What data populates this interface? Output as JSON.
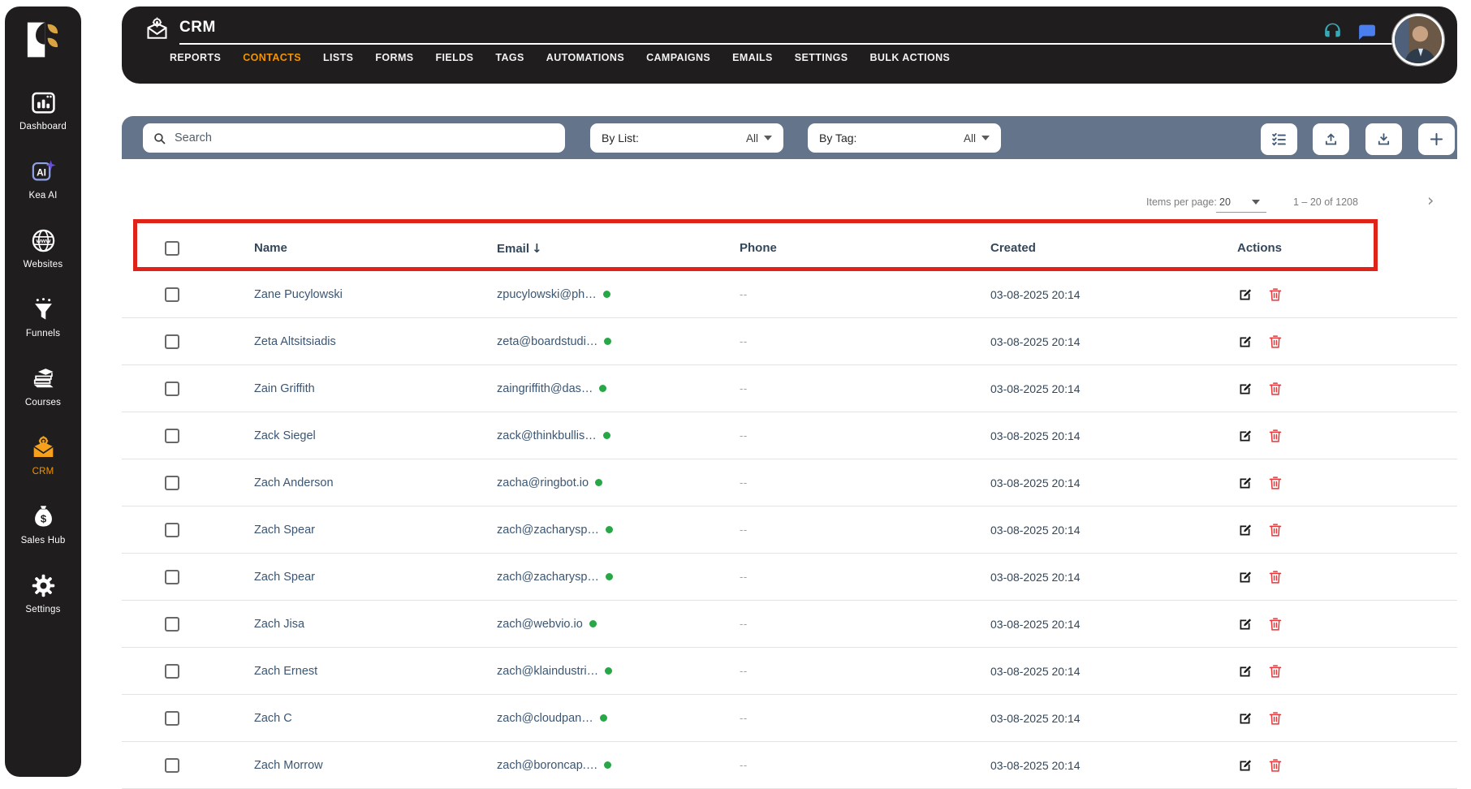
{
  "app": {
    "title": "CRM"
  },
  "sidebar": {
    "logo_icon": "kea-bird-logo",
    "items": [
      {
        "label": "Dashboard",
        "icon": "dashboard-icon",
        "active": false
      },
      {
        "label": "Kea AI",
        "icon": "kea-ai-icon",
        "active": false
      },
      {
        "label": "Websites",
        "icon": "websites-icon",
        "active": false
      },
      {
        "label": "Funnels",
        "icon": "funnels-icon",
        "active": false
      },
      {
        "label": "Courses",
        "icon": "courses-icon",
        "active": false
      },
      {
        "label": "CRM",
        "icon": "crm-icon",
        "active": true
      },
      {
        "label": "Sales Hub",
        "icon": "sales-hub-icon",
        "active": false
      },
      {
        "label": "Settings",
        "icon": "settings-icon",
        "active": false
      }
    ]
  },
  "header": {
    "title": "CRM",
    "app_icon": "envelope-gear-icon",
    "nav": [
      {
        "label": "REPORTS",
        "active": false
      },
      {
        "label": "CONTACTS",
        "active": true
      },
      {
        "label": "LISTS",
        "active": false
      },
      {
        "label": "FORMS",
        "active": false
      },
      {
        "label": "FIELDS",
        "active": false
      },
      {
        "label": "TAGS",
        "active": false
      },
      {
        "label": "AUTOMATIONS",
        "active": false
      },
      {
        "label": "CAMPAIGNS",
        "active": false
      },
      {
        "label": "EMAILS",
        "active": false
      },
      {
        "label": "SETTINGS",
        "active": false
      },
      {
        "label": "BULK ACTIONS",
        "active": false
      }
    ],
    "right_icons": [
      "headset-icon",
      "chat-icon",
      "avatar"
    ]
  },
  "toolbar": {
    "search_placeholder": "Search",
    "filters": [
      {
        "label": "By List:",
        "value": "All"
      },
      {
        "label": "By Tag:",
        "value": "All"
      }
    ],
    "buttons": [
      "bulk-select-button",
      "import-button",
      "export-button",
      "add-contact-button"
    ]
  },
  "pagination": {
    "items_per_page_label": "Items per page:",
    "items_per_page": "20",
    "range_label": "1 – 20 of 1208",
    "next_icon": "›"
  },
  "table": {
    "sort_icon": "↓",
    "columns": [
      {
        "label": "Name",
        "sorted": null
      },
      {
        "label": "Email",
        "sorted": "desc"
      },
      {
        "label": "Phone",
        "sorted": null
      },
      {
        "label": "Created",
        "sorted": null
      },
      {
        "label": "Actions",
        "sorted": null
      }
    ],
    "rows": [
      {
        "name": "Zane Pucylowski",
        "email": "zpucylowski@ph…",
        "email_status": "active",
        "phone": "--",
        "created": "03-08-2025 20:14"
      },
      {
        "name": "Zeta Altsitsiadis",
        "email": "zeta@boardstudi…",
        "email_status": "active",
        "phone": "--",
        "created": "03-08-2025 20:14"
      },
      {
        "name": "Zain Griffith",
        "email": "zaingriffith@das…",
        "email_status": "active",
        "phone": "--",
        "created": "03-08-2025 20:14"
      },
      {
        "name": "Zack Siegel",
        "email": "zack@thinkbullis…",
        "email_status": "active",
        "phone": "--",
        "created": "03-08-2025 20:14"
      },
      {
        "name": "Zach Anderson",
        "email": "zacha@ringbot.io",
        "email_status": "active",
        "phone": "--",
        "created": "03-08-2025 20:14"
      },
      {
        "name": "Zach Spear",
        "email": "zach@zacharysp…",
        "email_status": "active",
        "phone": "--",
        "created": "03-08-2025 20:14"
      },
      {
        "name": "Zach Spear",
        "email": "zach@zacharysp…",
        "email_status": "active",
        "phone": "--",
        "created": "03-08-2025 20:14"
      },
      {
        "name": "Zach Jisa",
        "email": "zach@webvio.io",
        "email_status": "active",
        "phone": "--",
        "created": "03-08-2025 20:14"
      },
      {
        "name": "Zach Ernest",
        "email": "zach@klaindustri…",
        "email_status": "active",
        "phone": "--",
        "created": "03-08-2025 20:14"
      },
      {
        "name": "Zach C",
        "email": "zach@cloudpan…",
        "email_status": "active",
        "phone": "--",
        "created": "03-08-2025 20:14"
      },
      {
        "name": "Zach Morrow",
        "email": "zach@boroncap.…",
        "email_status": "active",
        "phone": "--",
        "created": "03-08-2025 20:14"
      }
    ]
  },
  "annotation": {
    "type": "highlight-box",
    "target": "table-header-row",
    "color": "#e02318"
  },
  "colors": {
    "dark": "#1f1d1d",
    "accent_orange": "#f29400",
    "toolbar_slate": "#64748b",
    "text_blue_gray": "#3a5674",
    "status_green": "#27a745",
    "danger_red": "#e5383b",
    "annotation_red": "#e02318"
  }
}
